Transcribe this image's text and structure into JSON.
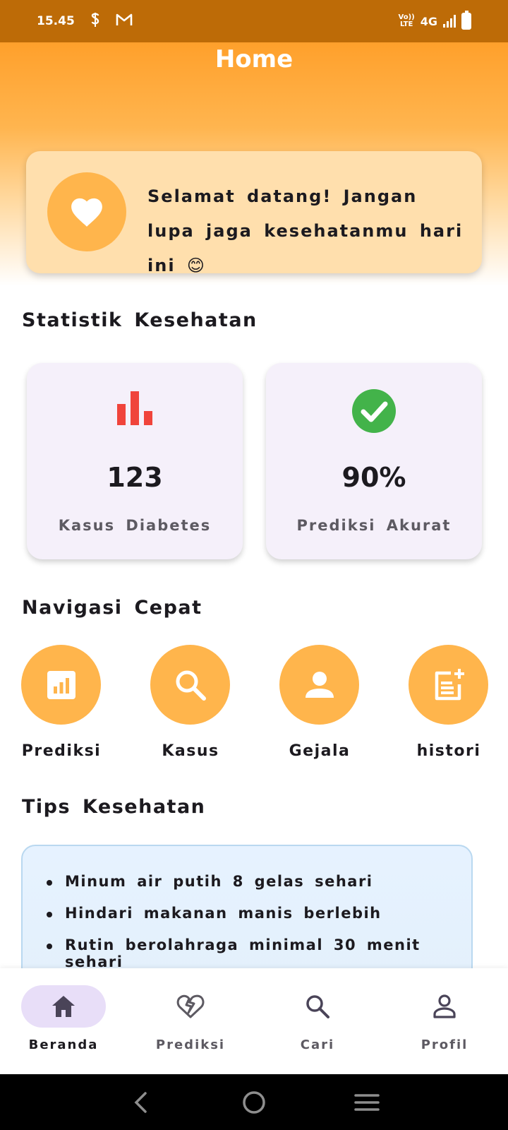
{
  "status_bar": {
    "time": "15.45",
    "network": "4G",
    "lte_top": "Vo))",
    "lte_bottom": "LTE"
  },
  "header": {
    "title": "Home"
  },
  "welcome": {
    "message": "Selamat datang! Jangan lupa jaga kesehatanmu hari ini 😊"
  },
  "stats": {
    "title": "Statistik Kesehatan",
    "cards": [
      {
        "value": "123",
        "label": "Kasus Diabetes",
        "icon": "bar-chart-icon",
        "icon_color": "#f0443b"
      },
      {
        "value": "90%",
        "label": "Prediksi Akurat",
        "icon": "check-circle-icon",
        "icon_color": "#43b34a"
      }
    ]
  },
  "quick_nav": {
    "title": "Navigasi Cepat",
    "items": [
      {
        "label": "Prediksi",
        "icon": "chart-box-icon"
      },
      {
        "label": "Kasus",
        "icon": "search-icon"
      },
      {
        "label": "Gejala",
        "icon": "person-icon"
      },
      {
        "label": "histori",
        "icon": "note-add-icon"
      }
    ]
  },
  "tips": {
    "title": "Tips Kesehatan",
    "items": [
      "Minum air putih 8 gelas sehari",
      "Hindari makanan manis berlebih",
      "Rutin berolahraga minimal 30 menit sehari"
    ]
  },
  "bottom_nav": {
    "items": [
      {
        "label": "Beranda",
        "icon": "home-icon",
        "active": true
      },
      {
        "label": "Prediksi",
        "icon": "heart-broken-icon",
        "active": false
      },
      {
        "label": "Cari",
        "icon": "search-icon",
        "active": false
      },
      {
        "label": "Profil",
        "icon": "person-outline-icon",
        "active": false
      }
    ]
  },
  "colors": {
    "accent": "#ffb54c",
    "header_top": "#ffa02b",
    "status_bar": "#bd6b07",
    "active_pill": "#e8def8"
  }
}
